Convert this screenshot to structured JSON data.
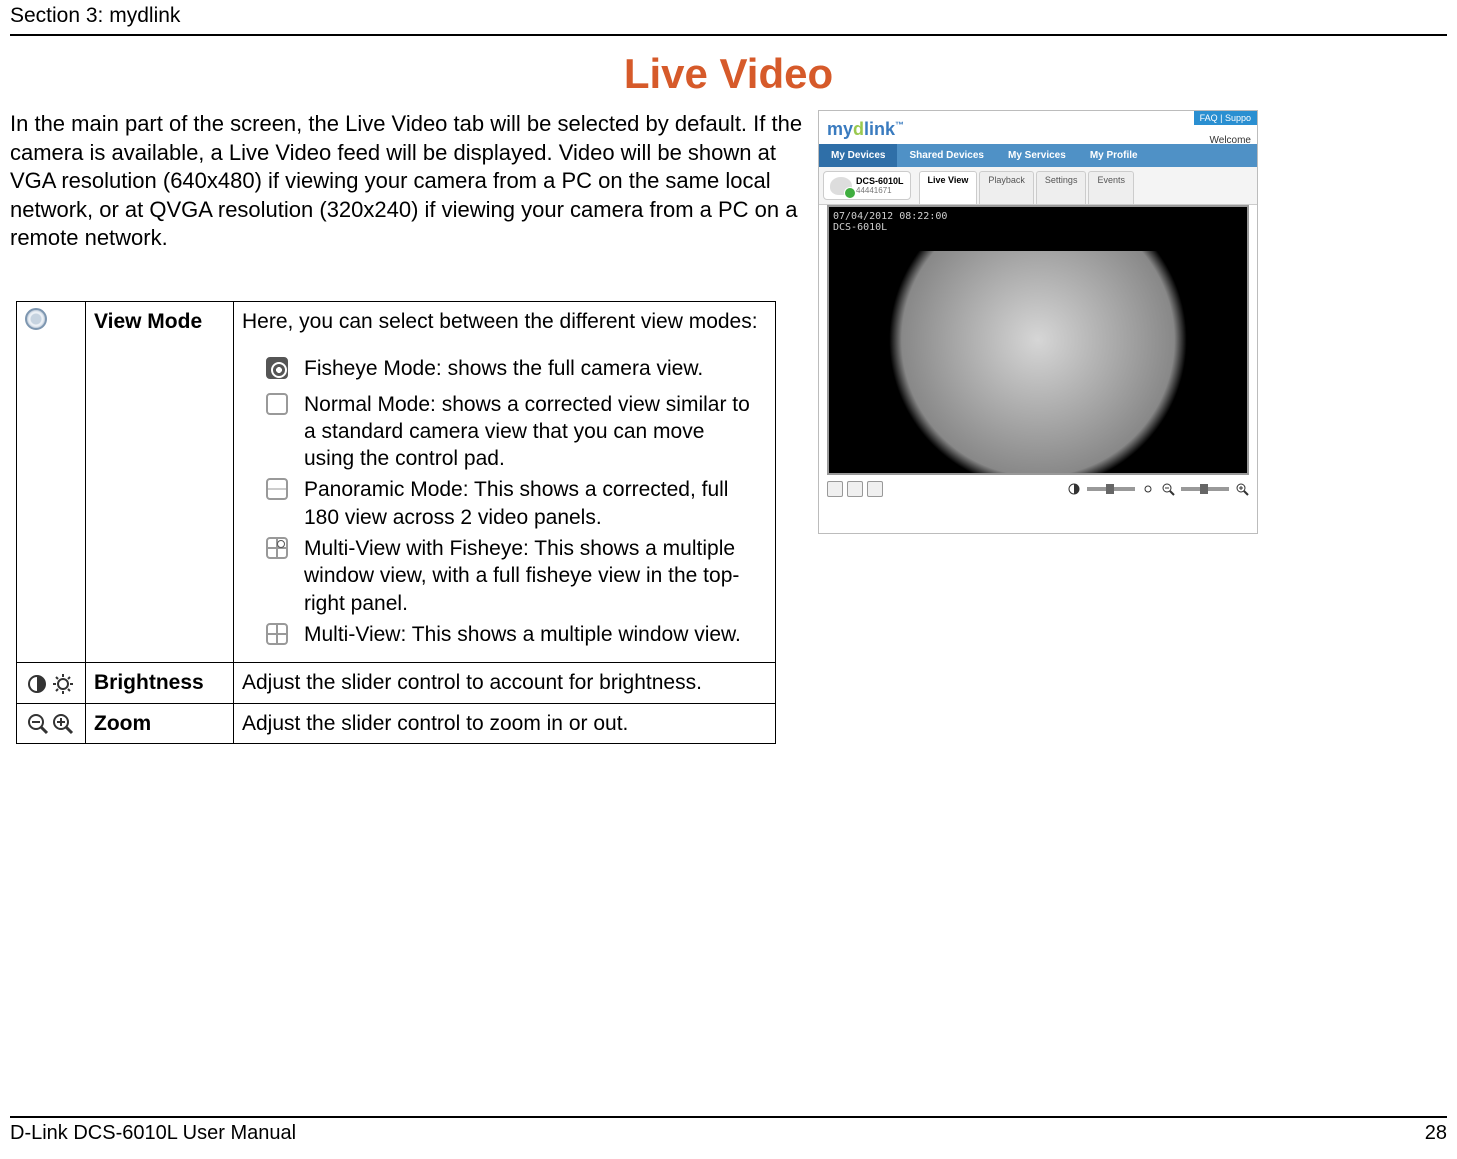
{
  "header": {
    "section": "Section 3: mydlink"
  },
  "title": "Live Video",
  "intro": "In the main part of the screen, the Live Video tab will be selected by default. If the camera is available, a Live Video feed will be displayed. Video will be shown at VGA resolution (640x480) if viewing your camera from a PC on the same local network, or at QVGA resolution (320x240) if viewing your camera from a PC on a remote network.",
  "table": {
    "rows": [
      {
        "icon": "viewmode-radio-icon",
        "label": "View Mode",
        "intro": "Here, you can select between the different view modes:",
        "modes": [
          {
            "icon": "fisheye-icon",
            "text": "Fisheye Mode: shows the full camera view."
          },
          {
            "icon": "normal-icon",
            "text": "Normal Mode: shows a corrected view similar to a standard camera view that you can move using the control pad."
          },
          {
            "icon": "panoramic-icon",
            "text": "Panoramic Mode: This shows a corrected, full 180 view across 2 video panels."
          },
          {
            "icon": "multiview-fisheye-icon",
            "text": "Multi-View with Fisheye: This shows a multiple window view, with a full fisheye view in the top-right panel."
          },
          {
            "icon": "multiview-icon",
            "text": "Multi-View: This shows a multiple window view."
          }
        ]
      },
      {
        "icon": "brightness-icon",
        "label": "Brightness",
        "desc": "Adjust the slider control to account for brightness."
      },
      {
        "icon": "zoom-icon",
        "label": "Zoom",
        "desc": "Adjust the slider control to zoom in or out."
      }
    ]
  },
  "screenshot": {
    "top_links": "FAQ | Suppo",
    "welcome": "Welcome",
    "logo": {
      "brand_prefix": "my",
      "brand_d": "d",
      "brand_link": "link",
      "tm": "™"
    },
    "nav": [
      "My Devices",
      "Shared Devices",
      "My Services",
      "My Profile"
    ],
    "device": {
      "name": "DCS-6010L",
      "serial": "44441671"
    },
    "sub_tabs": [
      "Live View",
      "Playback",
      "Settings",
      "Events"
    ],
    "overlay_line1": "07/04/2012 08:22:00",
    "overlay_line2": "DCS-6010L"
  },
  "footer": {
    "left": "D-Link DCS-6010L User Manual",
    "right": "28"
  }
}
